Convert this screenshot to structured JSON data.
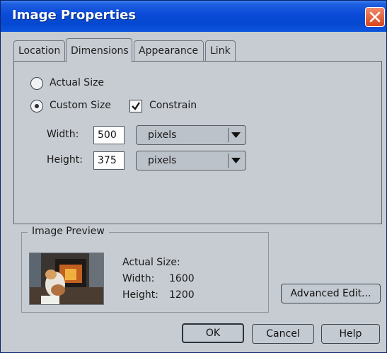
{
  "window": {
    "title": "Image Properties"
  },
  "tabs": [
    {
      "label": "Location",
      "active": false
    },
    {
      "label": "Dimensions",
      "active": true
    },
    {
      "label": "Appearance",
      "active": false
    },
    {
      "label": "Link",
      "active": false
    }
  ],
  "dimensions": {
    "actual_size_label": "Actual Size",
    "actual_size_selected": false,
    "custom_size_label": "Custom Size",
    "custom_size_selected": true,
    "constrain_label": "Constrain",
    "constrain_checked": true,
    "width_label": "Width:",
    "width_value": "500",
    "width_unit": "pixels",
    "height_label": "Height:",
    "height_value": "375",
    "height_unit": "pixels"
  },
  "preview": {
    "group_label": "Image Preview",
    "actual_size_label": "Actual Size:",
    "width_label": "Width:",
    "width_value": "1600",
    "height_label": "Height:",
    "height_value": "1200"
  },
  "buttons": {
    "advanced_edit": "Advanced Edit...",
    "ok": "OK",
    "cancel": "Cancel",
    "help": "Help"
  },
  "colors": {
    "titlebar": "#0a4ad8",
    "dialog_bg": "#c7ccd2",
    "close_button": "#d6451c"
  }
}
